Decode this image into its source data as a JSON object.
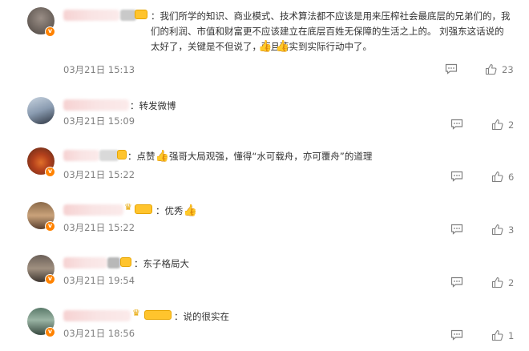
{
  "comments": [
    {
      "text": "我们所学的知识、商业模式、技术算法都不应该是用来压榨社会最底层的兄弟们的，我们的利润、市值和财富更不应该建立在底层百姓无保障的生活之上的。 刘强东这话说的太好了，关键是不但说了，而且落实到实际行动中了。",
      "emoji": "👍 👍",
      "time": "03月21日 15:13",
      "likes": "23"
    },
    {
      "text": "转发微博",
      "time": "03月21日 15:09",
      "likes": "2"
    },
    {
      "prefix": "点赞",
      "text": "强哥大局观强，懂得“水可载舟，亦可覆舟”的道理",
      "time": "03月21日 15:22",
      "likes": "6"
    },
    {
      "text": "优秀",
      "time": "03月21日 15:22",
      "likes": "3"
    },
    {
      "text": "东子格局大",
      "time": "03月21日 19:54",
      "likes": "2"
    },
    {
      "text": "说的很实在",
      "time": "03月21日 18:56",
      "likes": "1"
    }
  ],
  "colon": "：",
  "verified_mark": "v",
  "thumb_glyph": "👍",
  "colors": {
    "verified": "#ff8200",
    "meta": "#808080",
    "text": "#333333",
    "badge": "#ffc42d"
  },
  "icons": [
    "comment-reply-icon",
    "like-thumb-icon",
    "verified-badge-icon",
    "level-badge-icon",
    "crown-icon"
  ]
}
